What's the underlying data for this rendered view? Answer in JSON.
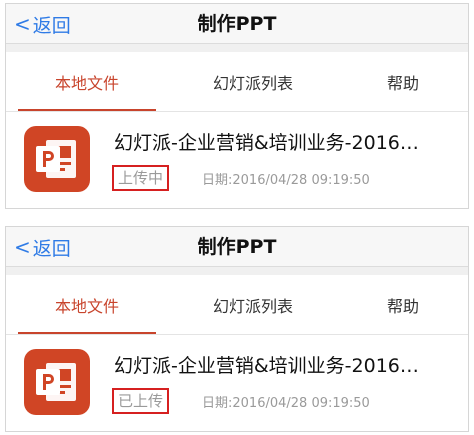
{
  "screens": [
    {
      "back_label": "返回",
      "title": "制作PPT",
      "tabs": {
        "local": "本地文件",
        "list": "幻灯派列表",
        "help": "帮助"
      },
      "file": {
        "name": "幻灯派-企业营销&培训业务-2016…",
        "status": "上传中",
        "date": "日期:2016/04/28 09:19:50"
      }
    },
    {
      "back_label": "返回",
      "title": "制作PPT",
      "tabs": {
        "local": "本地文件",
        "list": "幻灯派列表",
        "help": "帮助"
      },
      "file": {
        "name": "幻灯派-企业营销&培训业务-2016…",
        "status": "已上传",
        "date": "日期:2016/04/28 09:19:50"
      }
    }
  ],
  "icons": {
    "back": "chevron-left-icon",
    "file": "powerpoint-file-icon"
  },
  "colors": {
    "accent": "#c8442c",
    "link": "#2f7be6",
    "icon_bg": "#d04525",
    "highlight_box": "#d62020"
  }
}
